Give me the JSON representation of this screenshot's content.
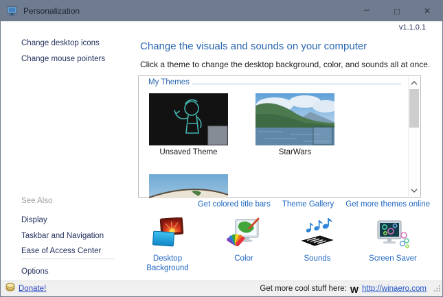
{
  "colors": {
    "titlebar_bg": "#6f7b8e",
    "accent_blue": "#2a66b0",
    "link_blue": "#1e66c0",
    "sidebar_link_navy": "#24315e",
    "footer_bg": "#f0f0f0"
  },
  "window": {
    "title": "Personalization",
    "version": "v1.1.0.1",
    "controls": {
      "minimize": "–",
      "maximize": "□",
      "close": "✕"
    }
  },
  "sidebar": {
    "links": [
      {
        "label": "Change desktop icons"
      },
      {
        "label": "Change mouse pointers"
      }
    ],
    "see_also": {
      "header": "See Also",
      "links": [
        {
          "label": "Display"
        },
        {
          "label": "Taskbar and Navigation"
        },
        {
          "label": "Ease of Access Center"
        }
      ]
    },
    "options_label": "Options"
  },
  "main": {
    "heading": "Change the visuals and sounds on your computer",
    "subtitle": "Click a theme to change the desktop background, color, and sounds all at once.",
    "themes_group_label": "My Themes",
    "themes": [
      {
        "name": "Unsaved Theme"
      },
      {
        "name": "StarWars"
      },
      {
        "name": ""
      }
    ],
    "theme_links": [
      {
        "label": "Get colored title bars"
      },
      {
        "label": "Theme Gallery"
      },
      {
        "label": "Get more themes online"
      }
    ],
    "setting_buttons": [
      {
        "label": "Desktop Background"
      },
      {
        "label": "Color"
      },
      {
        "label": "Sounds"
      },
      {
        "label": "Screen Saver"
      }
    ]
  },
  "footer": {
    "donate_label": "Donate!",
    "promo_text": "Get more cool stuff here:",
    "winaero_logo": "W",
    "winaero_link": "http://winaero.com"
  }
}
